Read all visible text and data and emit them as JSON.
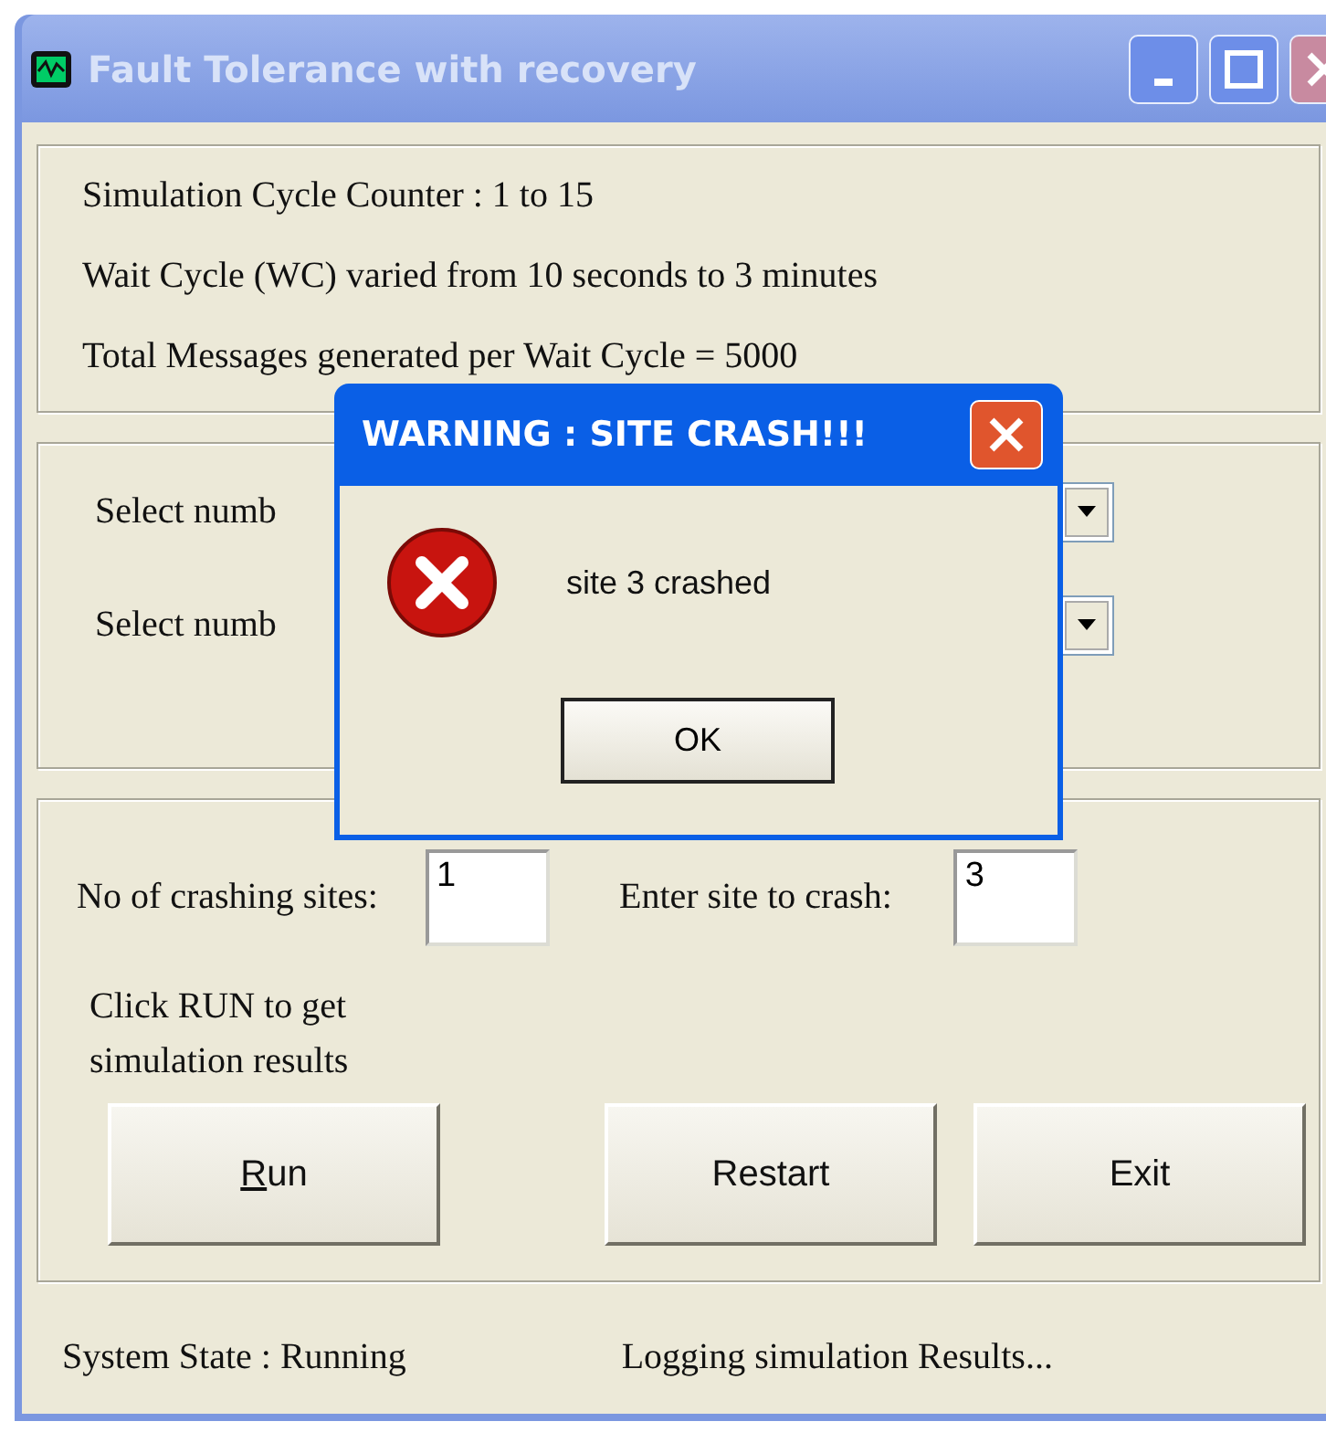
{
  "window": {
    "title": "Fault Tolerance with recovery",
    "active": false
  },
  "info_lines": [
    "Simulation Cycle Counter  : 1 to 15",
    "Wait Cycle (WC) varied from 10 seconds to 3 minutes",
    "Total Messages generated per Wait Cycle = 5000"
  ],
  "selectors": [
    {
      "label": "Select numb"
    },
    {
      "label": "Select numb"
    }
  ],
  "crash": {
    "count_label": "No of crashing sites:",
    "count_value": "1",
    "site_label": "Enter site to crash:",
    "site_value": "3"
  },
  "hint": "Click RUN to get simulation results",
  "buttons": [
    {
      "label": "Run",
      "underline_first": true
    },
    {
      "label": "Restart",
      "underline_first": false
    },
    {
      "label": "Exit",
      "underline_first": false
    }
  ],
  "status": {
    "state": "System State : Running",
    "message": "Logging simulation Results..."
  },
  "dialog": {
    "title": "WARNING : SITE CRASH!!!",
    "kind": "error",
    "message": "site 3 crashed",
    "button": "OK"
  }
}
